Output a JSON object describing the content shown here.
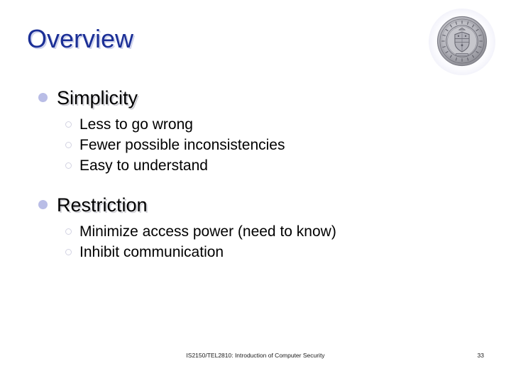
{
  "slide": {
    "title": "Overview",
    "title_color": "#1B2F96",
    "background_color": "#ffffff",
    "body_text_color": "#000000",
    "level1_bullet_color": "#B9BDE6",
    "level2_bullet_color": "#D3D3E2"
  },
  "logo": {
    "name": "university-seal",
    "description": "University of Pittsburgh seal",
    "ring_text_top": "UNIVERSITY",
    "ring_text_bottom": "OF PITTSBURGH",
    "color": "#8e8e94"
  },
  "sections": [
    {
      "heading": "Simplicity",
      "items": [
        "Less to go wrong",
        "Fewer possible inconsistencies",
        "Easy to understand"
      ]
    },
    {
      "heading": "Restriction",
      "items": [
        "Minimize access power (need to know)",
        "Inhibit communication"
      ]
    }
  ],
  "footer": {
    "course": "IS2150/TEL2810: Introduction of Computer Security",
    "page_number": "33"
  }
}
